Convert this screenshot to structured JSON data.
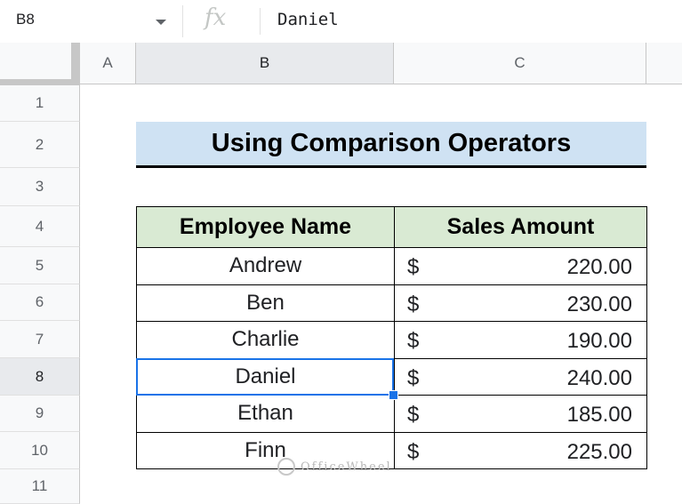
{
  "formula_bar": {
    "cell_reference": "B8",
    "fx_label": "fx",
    "content": "Daniel"
  },
  "columns": [
    "A",
    "B",
    "C"
  ],
  "rows": [
    "1",
    "2",
    "3",
    "4",
    "5",
    "6",
    "7",
    "8",
    "9",
    "10",
    "11"
  ],
  "selected": {
    "column": "B",
    "row": "8"
  },
  "sheet": {
    "title": "Using Comparison Operators",
    "headers": {
      "name": "Employee Name",
      "amount": "Sales Amount"
    },
    "currency_symbol": "$",
    "records": [
      {
        "name": "Andrew",
        "amount": "220.00"
      },
      {
        "name": "Ben",
        "amount": "230.00"
      },
      {
        "name": "Charlie",
        "amount": "190.00"
      },
      {
        "name": "Daniel",
        "amount": "240.00"
      },
      {
        "name": "Ethan",
        "amount": "185.00"
      },
      {
        "name": "Finn",
        "amount": "225.00"
      }
    ]
  },
  "watermark": "OfficeWheel",
  "colors": {
    "title_fill": "#cfe2f3",
    "header_fill": "#d9ead3",
    "selection": "#1a73e8"
  }
}
